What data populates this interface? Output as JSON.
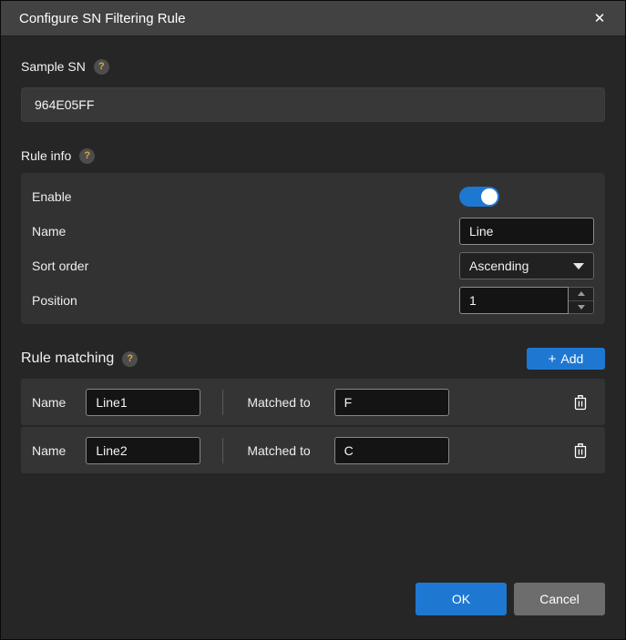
{
  "titlebar": {
    "title": "Configure SN Filtering Rule",
    "close": "✕"
  },
  "sample_sn": {
    "label": "Sample SN",
    "help": "?",
    "value": "964E05FF"
  },
  "rule_info": {
    "label": "Rule info",
    "help": "?",
    "enable": {
      "label": "Enable",
      "state": "on"
    },
    "name": {
      "label": "Name",
      "value": "Line"
    },
    "sort_order": {
      "label": "Sort order",
      "value": "Ascending"
    },
    "position": {
      "label": "Position",
      "value": "1"
    }
  },
  "rule_matching": {
    "label": "Rule matching",
    "help": "?",
    "add": {
      "plus": "+",
      "label": "Add"
    },
    "rows": [
      {
        "name_label": "Name",
        "name": "Line1",
        "matched_label": "Matched to",
        "matched": "F"
      },
      {
        "name_label": "Name",
        "name": "Line2",
        "matched_label": "Matched to",
        "matched": "C"
      }
    ]
  },
  "footer": {
    "ok": "OK",
    "cancel": "Cancel"
  },
  "colors": {
    "accent_blue": "#1e78d2",
    "help_icon_yellow": "#d9a93f",
    "titlebar_bg": "#424242",
    "dialog_bg": "#262626",
    "panel_bg": "#323232",
    "cancel_gray": "#6d6d6d"
  }
}
